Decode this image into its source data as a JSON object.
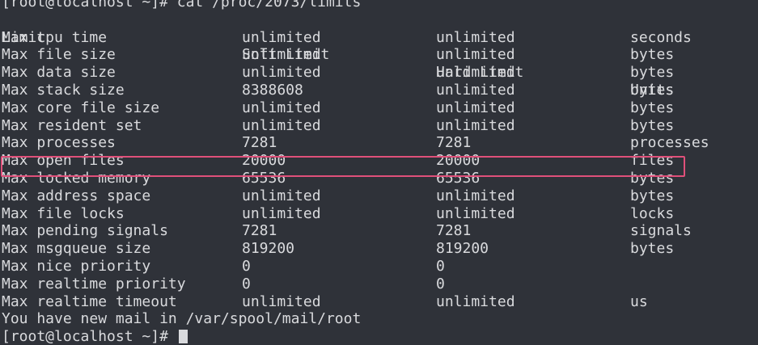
{
  "terminal": {
    "command_line": "[root@localhost ~]# cat /proc/2073/limits",
    "headers": [
      "Limit",
      "Soft Limit",
      "Hard Limit",
      "Units"
    ],
    "rows": [
      [
        "Max cpu time",
        "unlimited",
        "unlimited",
        "seconds"
      ],
      [
        "Max file size",
        "unlimited",
        "unlimited",
        "bytes"
      ],
      [
        "Max data size",
        "unlimited",
        "unlimited",
        "bytes"
      ],
      [
        "Max stack size",
        "8388608",
        "unlimited",
        "bytes"
      ],
      [
        "Max core file size",
        "unlimited",
        "unlimited",
        "bytes"
      ],
      [
        "Max resident set",
        "unlimited",
        "unlimited",
        "bytes"
      ],
      [
        "Max processes",
        "7281",
        "7281",
        "processes"
      ],
      [
        "Max open files",
        "20000",
        "20000",
        "files"
      ],
      [
        "Max locked memory",
        "65536",
        "65536",
        "bytes"
      ],
      [
        "Max address space",
        "unlimited",
        "unlimited",
        "bytes"
      ],
      [
        "Max file locks",
        "unlimited",
        "unlimited",
        "locks"
      ],
      [
        "Max pending signals",
        "7281",
        "7281",
        "signals"
      ],
      [
        "Max msgqueue size",
        "819200",
        "819200",
        "bytes"
      ],
      [
        "Max nice priority",
        "0",
        "0",
        ""
      ],
      [
        "Max realtime priority",
        "0",
        "0",
        ""
      ],
      [
        "Max realtime timeout",
        "unlimited",
        "unlimited",
        "us"
      ]
    ],
    "mail_notice": "You have new mail in /var/spool/mail/root",
    "prompt": "[root@localhost ~]# "
  },
  "colors": {
    "background": "#2f3239",
    "text": "#d9dadd",
    "highlight_border": "#e0507a"
  }
}
